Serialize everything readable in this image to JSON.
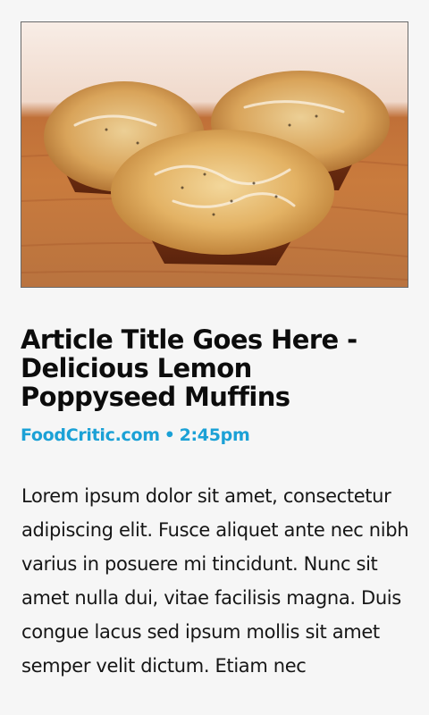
{
  "article": {
    "image_alt": "Lemon poppyseed muffins on a wooden table",
    "title": "Article Title Goes Here - Delicious Lemon Poppyseed Muffins",
    "source": "FoodCritic.com",
    "separator": "•",
    "time": "2:45pm",
    "body": "Lorem ipsum dolor sit amet, consectetur adipiscing elit. Fusce aliquet ante nec nibh varius in posuere mi tincidunt. Nunc sit amet nulla dui, vitae facilisis magna. Duis congue lacus sed ipsum mollis sit amet semper velit dictum. Etiam nec"
  },
  "colors": {
    "accent": "#1ba1d6",
    "background": "#f6f6f6",
    "text": "#111111"
  }
}
